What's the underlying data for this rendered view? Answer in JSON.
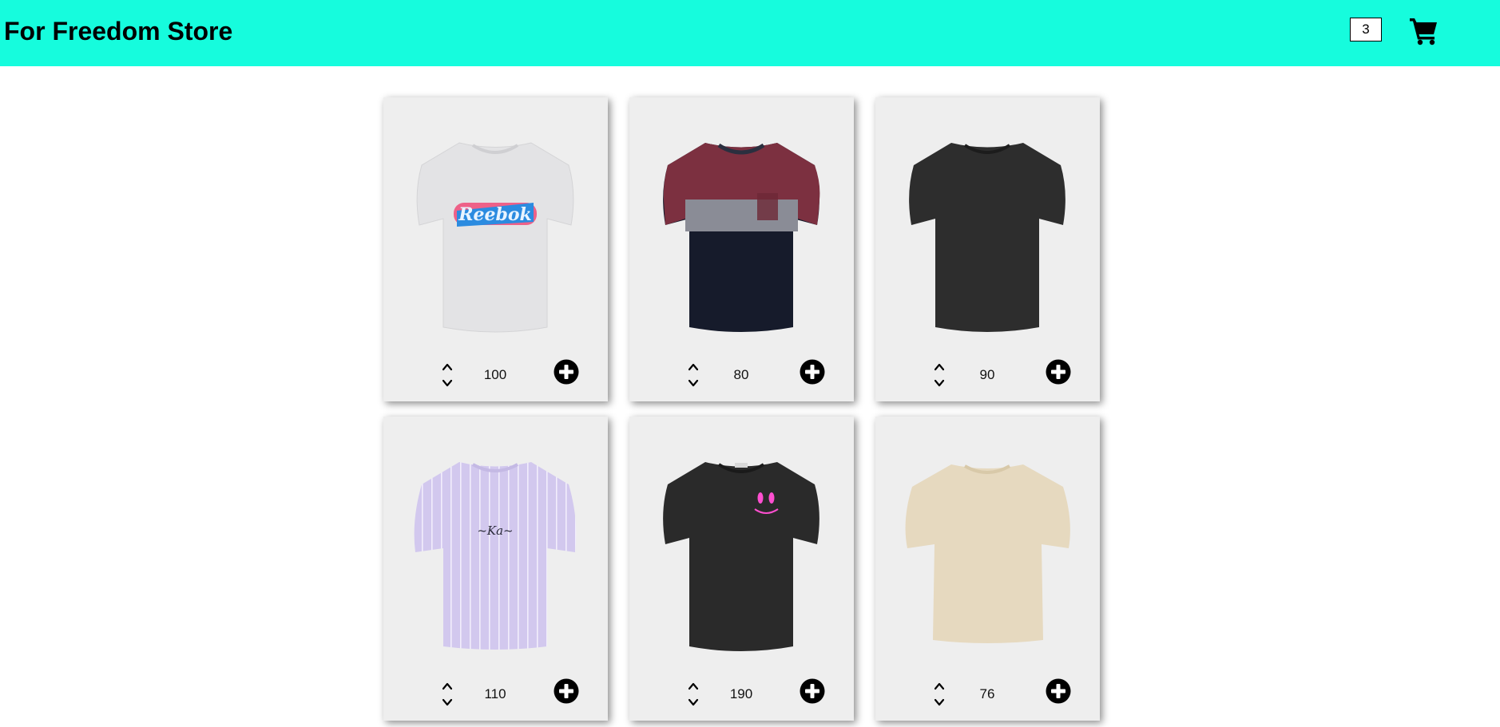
{
  "header": {
    "title": "For Freedom Store",
    "cart_count": "3",
    "cart_icon": "shopping-cart-icon"
  },
  "colors": {
    "header_bg": "#16fcdd",
    "card_bg": "#eeeeee",
    "icon": "#000000"
  },
  "products": [
    {
      "price": "100",
      "shirt": "light grey t-shirt with blue Reebok print",
      "image": "tshirt-reebok-grey"
    },
    {
      "price": "80",
      "shirt": "colour-block t-shirt with burgundy, grey and navy bands",
      "image": "tshirt-colorblock"
    },
    {
      "price": "90",
      "shirt": "plain black t-shirt",
      "image": "tshirt-black"
    },
    {
      "price": "110",
      "shirt": "lilac striped t-shirt with small logo",
      "image": "tshirt-lilac-striped"
    },
    {
      "price": "190",
      "shirt": "black t-shirt with pink smiley print",
      "image": "tshirt-black-smiley"
    },
    {
      "price": "76",
      "shirt": "beige oversized t-shirt",
      "image": "tshirt-beige"
    }
  ],
  "icons": {
    "stepper": "chevron-up-down-icon",
    "add": "plus-circle-icon"
  }
}
